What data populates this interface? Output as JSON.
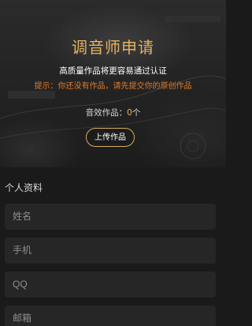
{
  "header": {
    "title": "调音师申请",
    "subtitle": "高质量作品将更容易通过认证",
    "hint": "提示：你还没有作品，请先提交你的原创作品"
  },
  "works": {
    "label": "音效作品：",
    "count": "0",
    "unit": "个"
  },
  "upload_button": {
    "label": "上传作品"
  },
  "profile": {
    "section_title": "个人资料",
    "fields": [
      {
        "placeholder": "姓名"
      },
      {
        "placeholder": "手机"
      },
      {
        "placeholder": "QQ"
      },
      {
        "placeholder": "邮箱"
      }
    ]
  },
  "colors": {
    "accent_gold": "#e6b15c",
    "hint_orange": "#e07a2a",
    "background": "#1a1a1a",
    "field_bg": "#262626"
  }
}
